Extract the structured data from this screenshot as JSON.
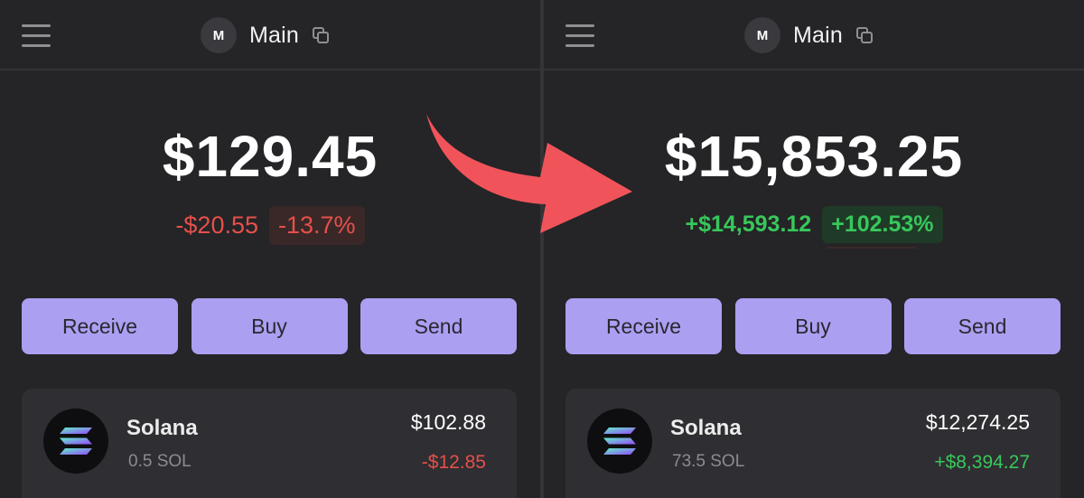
{
  "before": {
    "account": {
      "avatar_letter": "M",
      "name": "Main"
    },
    "balance": "$129.45",
    "change": {
      "amount": "-$20.55",
      "percent": "-13.7%"
    },
    "actions": {
      "receive": "Receive",
      "buy": "Buy",
      "send": "Send"
    },
    "token": {
      "name": "Solana",
      "amount": "0.5 SOL",
      "value": "$102.88",
      "change": "-$12.85"
    }
  },
  "after": {
    "account": {
      "avatar_letter": "M",
      "name": "Main"
    },
    "balance": "$15,853.25",
    "change": {
      "amount": "+$14,593.12",
      "percent": "+102.53%"
    },
    "actions": {
      "receive": "Receive",
      "buy": "Buy",
      "send": "Send"
    },
    "token": {
      "name": "Solana",
      "amount": "73.5 SOL",
      "value": "$12,274.25",
      "change": "+$8,394.27"
    }
  },
  "colors": {
    "accent_button": "#ab9ff2",
    "negative": "#e5504a",
    "positive": "#37c85b",
    "arrow": "#f0545a",
    "background": "#252427"
  },
  "icons": [
    "menu-icon",
    "copy-icon",
    "solana-logo-icon",
    "curved-arrow-icon"
  ]
}
